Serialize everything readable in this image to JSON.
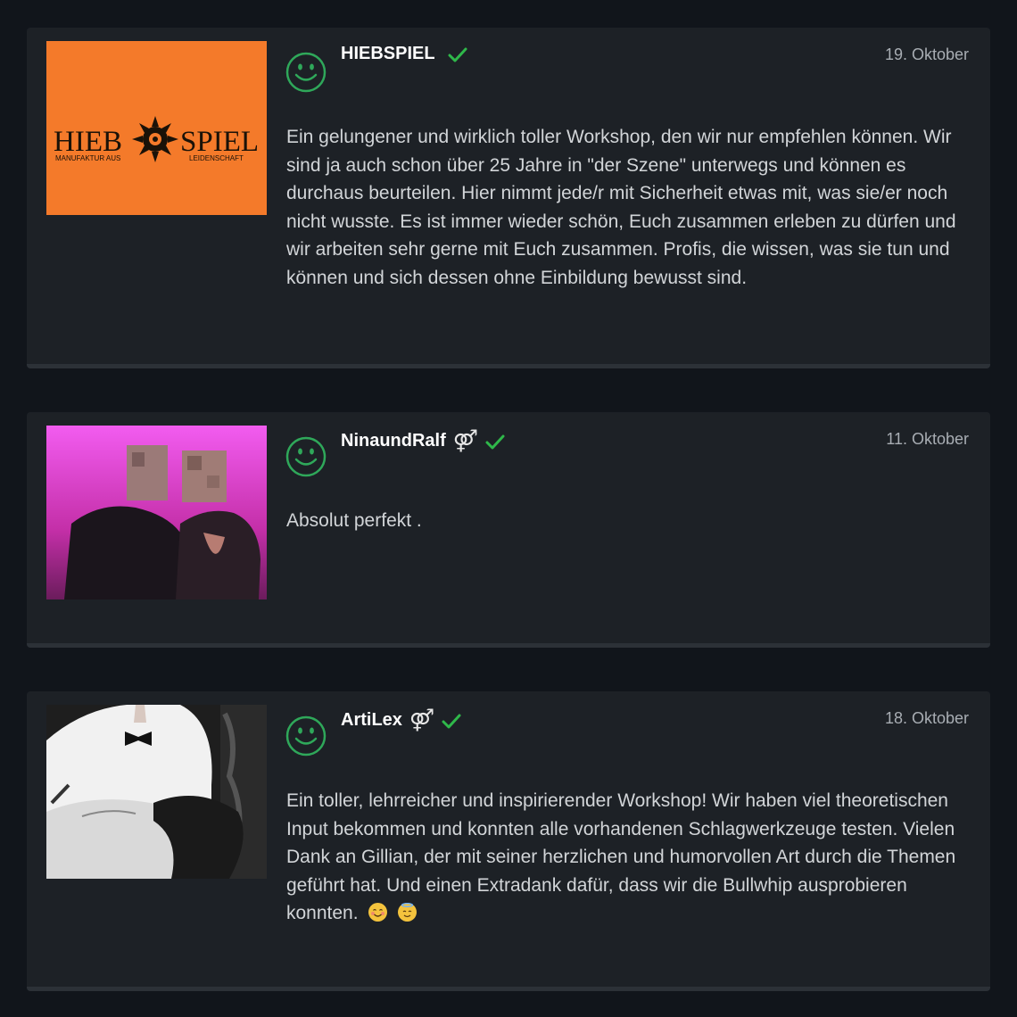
{
  "reviews": [
    {
      "username": "HIEBSPIEL",
      "gender_symbol": "",
      "verified": true,
      "date": "19. Oktober",
      "text": "Ein gelungener und wirklich toller Workshop, den wir nur empfehlen können. Wir sind ja auch schon über 25 Jahre in \"der Szene\" unterwegs und können es durchaus beurteilen. Hier nimmt jede/r mit Sicherheit etwas mit, was sie/er noch nicht wusste. Es ist immer wieder schön, Euch zusammen erleben zu dürfen und wir arbeiten sehr gerne mit Euch zusammen. Profis, die wissen, was sie tun und können und sich dessen ohne Einbildung bewusst sind.",
      "avatar": {
        "type": "logo",
        "logo_left": "HIEB",
        "logo_right": "SPIEL",
        "tagline_left": "MANUFAKTUR AUS",
        "tagline_right": "LEIDENSCHAFT",
        "bg_color": "#f47a2a"
      }
    },
    {
      "username": "NinaundRalf",
      "gender_symbol": "⚤",
      "verified": true,
      "date": "11. Oktober",
      "text": "Absolut perfekt .",
      "avatar": {
        "type": "photo",
        "description_icon": "couple-photo"
      }
    },
    {
      "username": "ArtiLex",
      "gender_symbol": "⚤",
      "verified": true,
      "date": "18. Oktober",
      "text": "Ein toller, lehrreicher und inspirierender Workshop! Wir haben viel theoretischen Input bekommen und konnten alle vorhandenen Schlagwerkzeuge testen. Vielen Dank an Gillian, der mit seiner herzlichen und humorvollen Art durch die Themen geführt hat. Und einen Extradank dafür, dass wir die Bullwhip ausprobieren konnten.",
      "emojis": [
        "smiling-face-icon",
        "angel-face-icon"
      ],
      "avatar": {
        "type": "photo",
        "description_icon": "bw-photo"
      }
    }
  ],
  "colors": {
    "page_bg": "#11151b",
    "card_bg": "#1d2126",
    "smiley": "#2fa85a",
    "check": "#2fb84a",
    "text": "#d2d5d8",
    "date": "#a8adb3"
  }
}
